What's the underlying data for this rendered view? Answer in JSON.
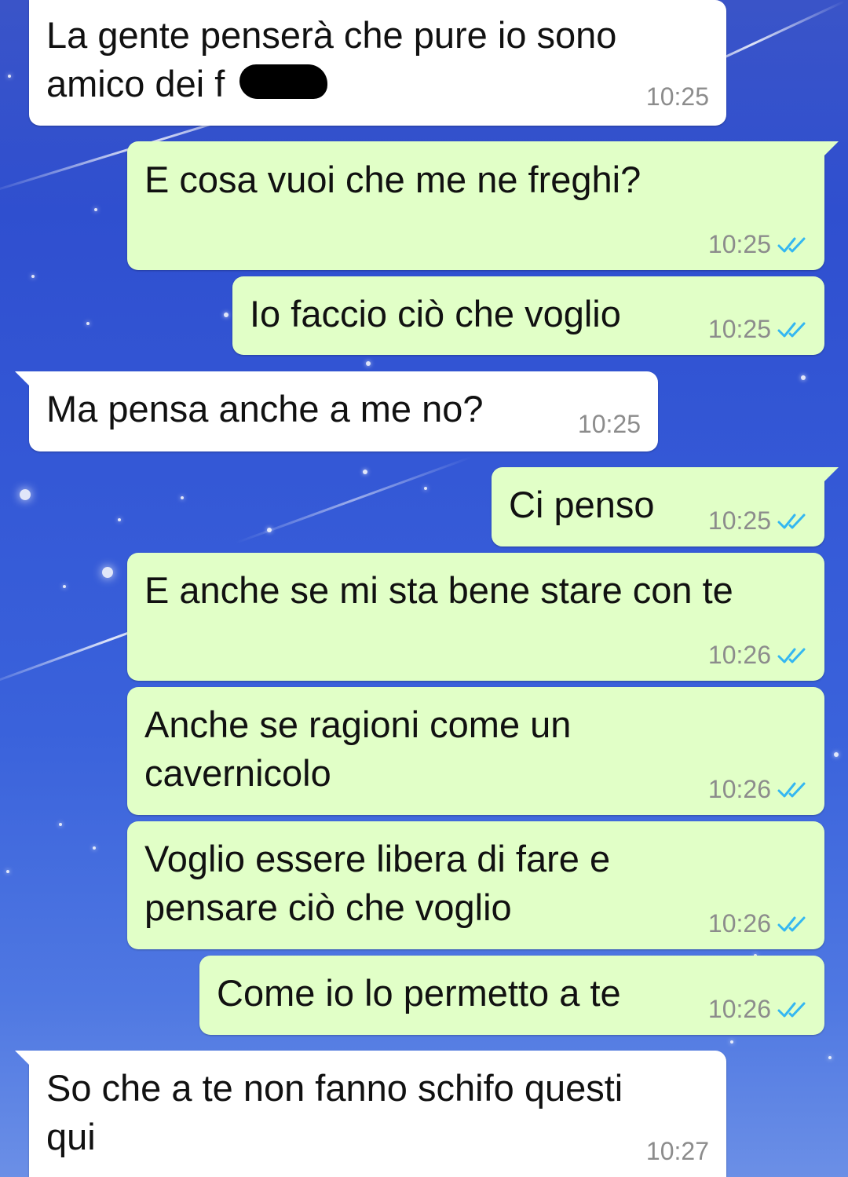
{
  "messages": [
    {
      "id": "m1",
      "direction": "incoming",
      "text": "La gente penserà che pure io sono\namico dei f",
      "time": "10:25"
    },
    {
      "id": "m2",
      "direction": "outgoing",
      "text": "E cosa vuoi che me ne freghi?",
      "time": "10:25",
      "status": "read"
    },
    {
      "id": "m3",
      "direction": "outgoing",
      "text": "Io faccio ciò che voglio",
      "time": "10:25",
      "status": "read"
    },
    {
      "id": "m4",
      "direction": "incoming",
      "text": "Ma pensa anche a me no?",
      "time": "10:25"
    },
    {
      "id": "m5",
      "direction": "outgoing",
      "text": "Ci penso",
      "time": "10:25",
      "status": "read"
    },
    {
      "id": "m6",
      "direction": "outgoing",
      "text": "E anche se mi sta bene stare con te",
      "time": "10:26",
      "status": "read"
    },
    {
      "id": "m7",
      "direction": "outgoing",
      "text": "Anche se ragioni come un\ncavernicolo",
      "time": "10:26",
      "status": "read"
    },
    {
      "id": "m8",
      "direction": "outgoing",
      "text": "Voglio essere libera di fare e\npensare ciò che voglio",
      "time": "10:26",
      "status": "read"
    },
    {
      "id": "m9",
      "direction": "outgoing",
      "text": "Come io lo permetto a te",
      "time": "10:26",
      "status": "read"
    },
    {
      "id": "m10",
      "direction": "incoming",
      "text": "So che a te non fanno schifo questi\nqui",
      "time": "10:27"
    }
  ],
  "icons": {
    "read_receipt": "double-check-icon"
  },
  "colors": {
    "incoming_bubble": "#ffffff",
    "outgoing_bubble": "#e1ffc7",
    "timestamp": "#8c8c8c",
    "read_tick": "#34b7f1",
    "wallpaper": "#3458d6"
  }
}
